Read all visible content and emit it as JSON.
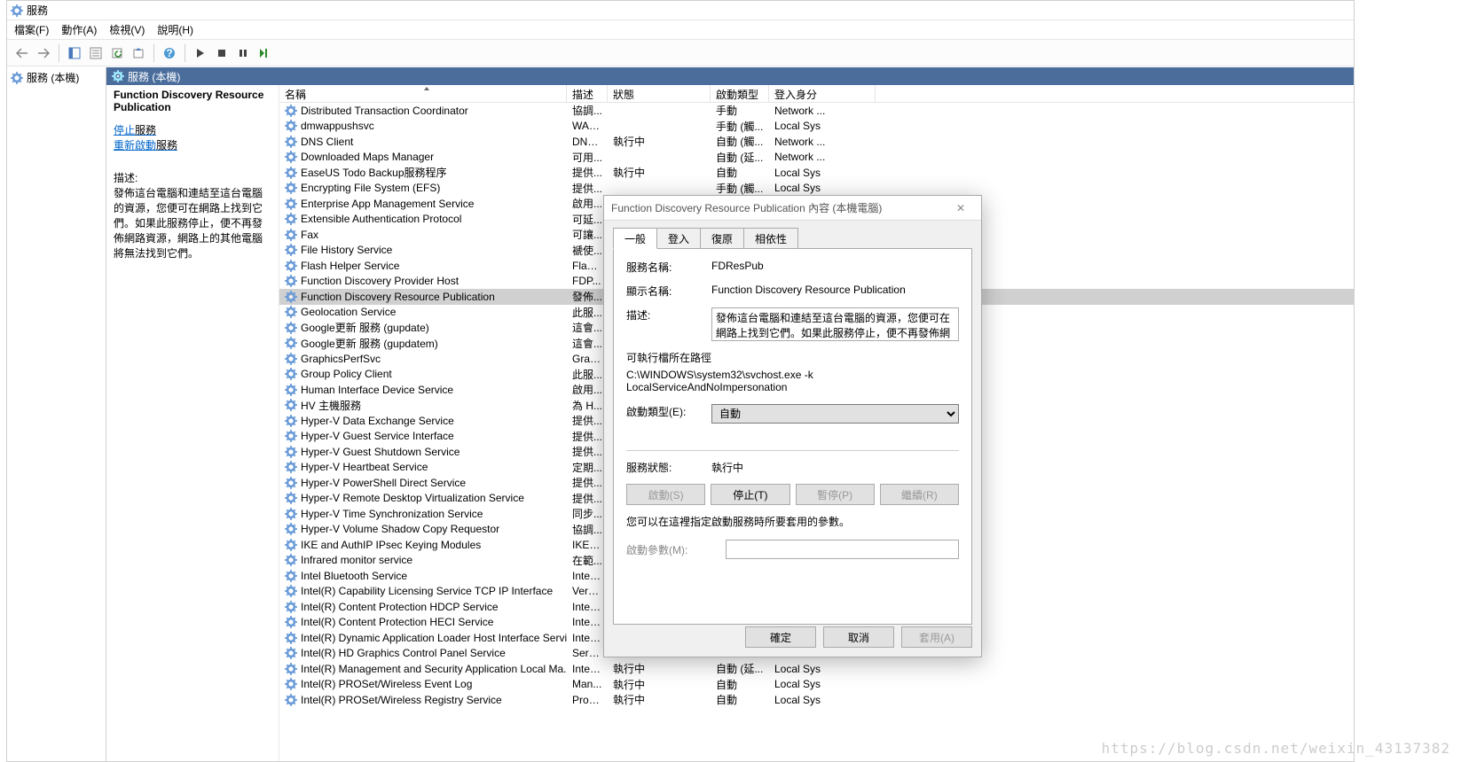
{
  "window_title": "服務",
  "menubar": [
    "檔案(F)",
    "動作(A)",
    "檢視(V)",
    "說明(H)"
  ],
  "sidebar_root": "服務 (本機)",
  "main_header": "服務 (本機)",
  "detail": {
    "title": "Function Discovery Resource Publication",
    "link_stop": "停止",
    "link_restart": "重新啟動",
    "link_suffix": "服務",
    "desc_label": "描述:",
    "desc_text": "發佈這台電腦和連結至這台電腦的資源，您便可在網路上找到它們。如果此服務停止，便不再發佈網路資源，網路上的其他電腦將無法找到它們。"
  },
  "columns": {
    "name": "名稱",
    "desc": "描述",
    "status": "狀態",
    "startup": "啟動類型",
    "logon": "登入身分"
  },
  "services": [
    {
      "name": "Distributed Transaction Coordinator",
      "desc": "協調...",
      "status": "",
      "startup": "手動",
      "logon": "Network ..."
    },
    {
      "name": "dmwappushsvc",
      "desc": "WAP...",
      "status": "",
      "startup": "手動 (觸...",
      "logon": "Local Sys"
    },
    {
      "name": "DNS Client",
      "desc": "DNS...",
      "status": "執行中",
      "startup": "自動 (觸...",
      "logon": "Network ..."
    },
    {
      "name": "Downloaded Maps Manager",
      "desc": "可用...",
      "status": "",
      "startup": "自動 (延...",
      "logon": "Network ..."
    },
    {
      "name": "EaseUS Todo Backup服務程序",
      "desc": "提供...",
      "status": "執行中",
      "startup": "自動",
      "logon": "Local Sys"
    },
    {
      "name": "Encrypting File System (EFS)",
      "desc": "提供...",
      "status": "",
      "startup": "手動 (觸...",
      "logon": "Local Sys"
    },
    {
      "name": "Enterprise App Management Service",
      "desc": "啟用...",
      "status": "",
      "startup": "",
      "logon": ""
    },
    {
      "name": "Extensible Authentication Protocol",
      "desc": "可延...",
      "status": "",
      "startup": "",
      "logon": ""
    },
    {
      "name": "Fax",
      "desc": "可讓...",
      "status": "",
      "startup": "",
      "logon": ""
    },
    {
      "name": "File History Service",
      "desc": "褫使...",
      "status": "",
      "startup": "",
      "logon": ""
    },
    {
      "name": "Flash Helper Service",
      "desc": "Flash...",
      "status": "",
      "startup": "",
      "logon": ""
    },
    {
      "name": "Function Discovery Provider Host",
      "desc": "FDP...",
      "status": "",
      "startup": "",
      "logon": ""
    },
    {
      "name": "Function Discovery Resource Publication",
      "desc": "發佈...",
      "status": "",
      "startup": "",
      "logon": "",
      "selected": true
    },
    {
      "name": "Geolocation Service",
      "desc": "此服...",
      "status": "",
      "startup": "",
      "logon": ""
    },
    {
      "name": "Google更新 服務 (gupdate)",
      "desc": "這會...",
      "status": "",
      "startup": "",
      "logon": ""
    },
    {
      "name": "Google更新 服務 (gupdatem)",
      "desc": "這會...",
      "status": "",
      "startup": "",
      "logon": ""
    },
    {
      "name": "GraphicsPerfSvc",
      "desc": "Grap...",
      "status": "",
      "startup": "",
      "logon": ""
    },
    {
      "name": "Group Policy Client",
      "desc": "此服...",
      "status": "",
      "startup": "",
      "logon": ""
    },
    {
      "name": "Human Interface Device Service",
      "desc": "啟用...",
      "status": "",
      "startup": "",
      "logon": ""
    },
    {
      "name": "HV 主機服務",
      "desc": "為 H...",
      "status": "",
      "startup": "",
      "logon": ""
    },
    {
      "name": "Hyper-V Data Exchange Service",
      "desc": "提供...",
      "status": "",
      "startup": "",
      "logon": ""
    },
    {
      "name": "Hyper-V Guest Service Interface",
      "desc": "提供...",
      "status": "",
      "startup": "",
      "logon": ""
    },
    {
      "name": "Hyper-V Guest Shutdown Service",
      "desc": "提供...",
      "status": "",
      "startup": "",
      "logon": ""
    },
    {
      "name": "Hyper-V Heartbeat Service",
      "desc": "定期...",
      "status": "",
      "startup": "",
      "logon": ""
    },
    {
      "name": "Hyper-V PowerShell Direct Service",
      "desc": "提供...",
      "status": "",
      "startup": "",
      "logon": ""
    },
    {
      "name": "Hyper-V Remote Desktop Virtualization Service",
      "desc": "提供...",
      "status": "",
      "startup": "",
      "logon": ""
    },
    {
      "name": "Hyper-V Time Synchronization Service",
      "desc": "同步...",
      "status": "",
      "startup": "",
      "logon": ""
    },
    {
      "name": "Hyper-V Volume Shadow Copy Requestor",
      "desc": "協調...",
      "status": "",
      "startup": "",
      "logon": ""
    },
    {
      "name": "IKE and AuthIP IPsec Keying Modules",
      "desc": "IKEE...",
      "status": "",
      "startup": "",
      "logon": ""
    },
    {
      "name": "Infrared monitor service",
      "desc": "在範...",
      "status": "",
      "startup": "",
      "logon": ""
    },
    {
      "name": "Intel Bluetooth Service",
      "desc": "Intel(...",
      "status": "",
      "startup": "",
      "logon": ""
    },
    {
      "name": "Intel(R) Capability Licensing Service TCP IP Interface",
      "desc": "Versi...",
      "status": "",
      "startup": "",
      "logon": ""
    },
    {
      "name": "Intel(R) Content Protection HDCP Service",
      "desc": "Intel(...",
      "status": "",
      "startup": "",
      "logon": ""
    },
    {
      "name": "Intel(R) Content Protection HECI Service",
      "desc": "Intel(...",
      "status": "",
      "startup": "",
      "logon": ""
    },
    {
      "name": "Intel(R) Dynamic Application Loader Host Interface Service",
      "desc": "Intel(...",
      "status": "",
      "startup": "",
      "logon": ""
    },
    {
      "name": "Intel(R) HD Graphics Control Panel Service",
      "desc": "Servi...",
      "status": "",
      "startup": "",
      "logon": ""
    },
    {
      "name": "Intel(R) Management and Security Application Local Ma...",
      "desc": "Intel(...",
      "status": "執行中",
      "startup": "自動 (延...",
      "logon": "Local Sys"
    },
    {
      "name": "Intel(R) PROSet/Wireless Event Log",
      "desc": "Man...",
      "status": "執行中",
      "startup": "自動",
      "logon": "Local Sys"
    },
    {
      "name": "Intel(R) PROSet/Wireless Registry Service",
      "desc": "Provi...",
      "status": "執行中",
      "startup": "自動",
      "logon": "Local Sys"
    }
  ],
  "dialog": {
    "title": "Function Discovery Resource Publication 內容 (本機電腦)",
    "tabs": [
      "一般",
      "登入",
      "復原",
      "相依性"
    ],
    "svc_name_label": "服務名稱:",
    "svc_name": "FDResPub",
    "display_name_label": "顯示名稱:",
    "display_name": "Function Discovery Resource Publication",
    "desc_label": "描述:",
    "desc": "發佈這台電腦和連結至這台電腦的資源，您便可在網路上找到它們。如果此服務停止，便不再發佈網路資源，",
    "exec_label": "可執行檔所在路徑",
    "exec_path": "C:\\WINDOWS\\system32\\svchost.exe -k LocalServiceAndNoImpersonation",
    "startup_label": "啟動類型(E):",
    "startup_value": "自動",
    "status_label": "服務狀態:",
    "status_value": "執行中",
    "btn_start": "啟動(S)",
    "btn_stop": "停止(T)",
    "btn_pause": "暫停(P)",
    "btn_resume": "繼續(R)",
    "param_hint": "您可以在這裡指定啟動服務時所要套用的參數。",
    "param_label": "啟動參數(M):",
    "btn_ok": "確定",
    "btn_cancel": "取消",
    "btn_apply": "套用(A)"
  },
  "watermark": "https://blog.csdn.net/weixin_43137382"
}
